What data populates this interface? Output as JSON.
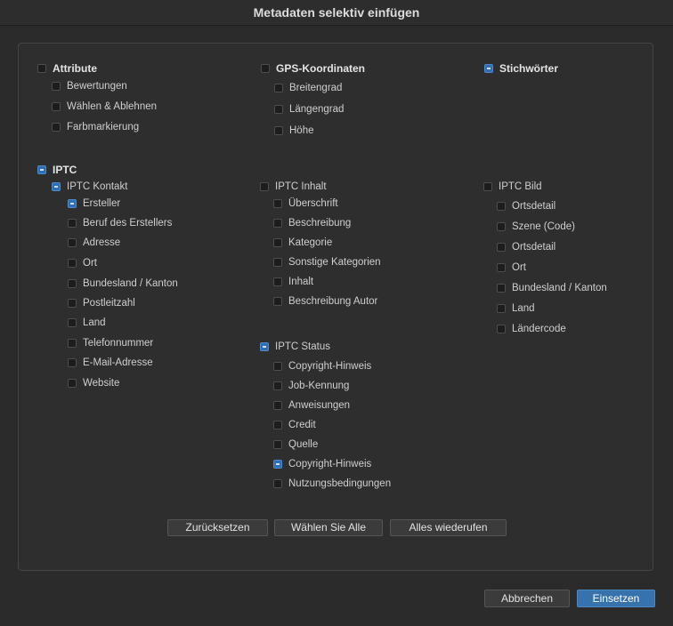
{
  "dialog": {
    "title": "Metadaten selektiv einfügen"
  },
  "sections": {
    "attribute": {
      "label": "Attribute",
      "checked": false,
      "items": [
        "Bewertungen",
        "Wählen & Ablehnen",
        "Farbmarkierung"
      ]
    },
    "gps": {
      "label": "GPS-Koordinaten",
      "checked": false,
      "items": [
        "Breitengrad",
        "Längengrad",
        "Höhe"
      ]
    },
    "stichwoerter": {
      "label": "Stichwörter",
      "checked": true
    },
    "iptc": {
      "label": "IPTC",
      "checked": true
    },
    "iptc_kontakt": {
      "label": "IPTC Kontakt",
      "checked": true,
      "items": [
        "Ersteller",
        "Beruf des Erstellers",
        "Adresse",
        "Ort",
        "Bundesland / Kanton",
        "Postleitzahl",
        "Land",
        "Telefonnummer",
        "E-Mail-Adresse",
        "Website"
      ],
      "checked_items": [
        true,
        false,
        false,
        false,
        false,
        false,
        false,
        false,
        false,
        false
      ]
    },
    "iptc_inhalt": {
      "label": "IPTC Inhalt",
      "checked": false,
      "items": [
        "Überschrift",
        "Beschreibung",
        "Kategorie",
        "Sonstige Kategorien",
        "Inhalt",
        "Beschreibung Autor"
      ]
    },
    "iptc_status": {
      "label": "IPTC Status",
      "checked": true,
      "items": [
        "Copyright-Hinweis",
        "Job-Kennung",
        "Anweisungen",
        "Credit",
        "Quelle",
        "Copyright-Hinweis",
        "Nutzungsbedingungen"
      ],
      "checked_items": [
        false,
        false,
        false,
        false,
        false,
        true,
        false
      ]
    },
    "iptc_bild": {
      "label": "IPTC Bild",
      "checked": false,
      "items": [
        "Ortsdetail",
        "Szene (Code)",
        "Ortsdetail",
        "Ort",
        "Bundesland / Kanton",
        "Land",
        "Ländercode"
      ]
    }
  },
  "buttons": {
    "reset": "Zurücksetzen",
    "select_all": "Wählen Sie Alle",
    "revoke_all": "Alles wiederufen",
    "cancel": "Abbrechen",
    "insert": "Einsetzen"
  },
  "colors": {
    "accent": "#3673ad",
    "background": "#2b2b2b"
  }
}
